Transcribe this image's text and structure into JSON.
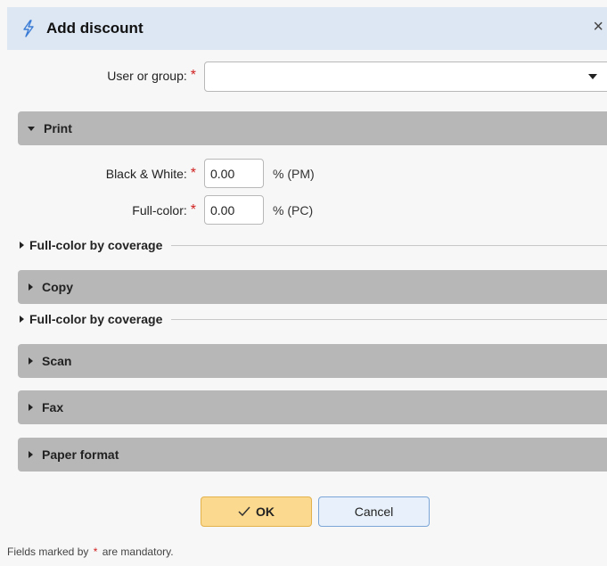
{
  "dialog": {
    "title": "Add discount",
    "title_icon": "lightning-icon",
    "close_label": "×"
  },
  "user_group": {
    "label": "User or group:",
    "required_mark": "*",
    "value": ""
  },
  "print_section": {
    "label": "Print",
    "expanded": true,
    "black_white": {
      "label": "Black & White:",
      "required_mark": "*",
      "value": "0.00",
      "unit": "% (PM)"
    },
    "full_color": {
      "label": "Full-color:",
      "required_mark": "*",
      "value": "0.00",
      "unit": "% (PC)"
    },
    "coverage_label": "Full-color by coverage"
  },
  "copy_section": {
    "label": "Copy",
    "expanded": false,
    "coverage_label": "Full-color by coverage"
  },
  "scan_section": {
    "label": "Scan",
    "expanded": false
  },
  "fax_section": {
    "label": "Fax",
    "expanded": false
  },
  "paper_format_section": {
    "label": "Paper format",
    "expanded": false
  },
  "buttons": {
    "ok_label": "OK",
    "ok_icon": "check-icon",
    "cancel_label": "Cancel"
  },
  "footnote": {
    "prefix": "Fields marked by",
    "mark": "*",
    "suffix": "are mandatory."
  },
  "colors": {
    "title_bar": "#dde7f3",
    "section_header": "#b7b7b7",
    "required": "#d02020",
    "ok_button": "#fbd98f",
    "cancel_button": "#e8f1fb"
  }
}
